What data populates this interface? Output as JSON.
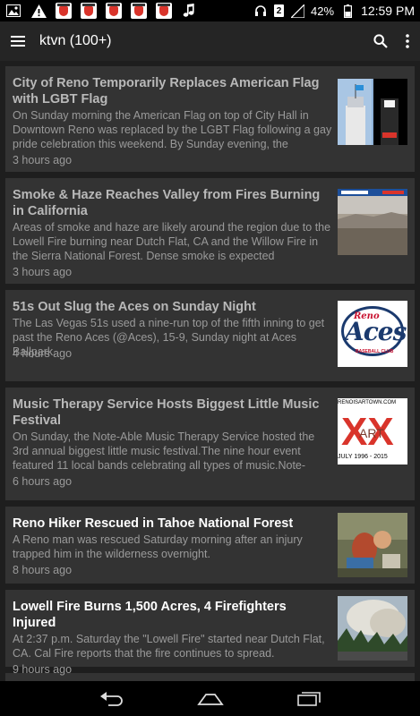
{
  "status_bar": {
    "battery": "42%",
    "time": "12:59 PM",
    "sim_label": "2"
  },
  "app_bar": {
    "title": "ktvn (100+)"
  },
  "articles": [
    {
      "title": "City of Reno Temporarily Replaces American Flag with LGBT Flag",
      "snippet": "On Sunday morning the American Flag on top of City Hall in Downtown Reno was replaced by the LGBT Flag following a gay pride celebration this weekend. By Sunday evening, the",
      "time": "3 hours ago",
      "thumb": "flag-photo"
    },
    {
      "title": "Smoke & Haze Reaches Valley from Fires Burning in California",
      "snippet": "Areas of smoke and haze are likely around the region due to the Lowell Fire burning near Dutch Flat, CA and the Willow Fire in the Sierra National Forest. Dense smoke is expected",
      "time": "3 hours ago",
      "thumb": "haze-photo"
    },
    {
      "title": "51s Out Slug the Aces on Sunday Night",
      "snippet": "The Las Vegas 51s used a nine-run top of the fifth inning to get past the Reno Aces (@Aces), 15-9, Sunday night at Aces Ballpark.",
      "time": "4 hours ago",
      "thumb": "aces-logo",
      "thumb_text": "Aces",
      "thumb_small": "Reno",
      "thumb_sub": "BASEBALL CLUB"
    },
    {
      "title": "Music Therapy Service Hosts Biggest Little Music Festival",
      "snippet": "On Sunday, the Note-Able Music Therapy Service hosted the 3rd annual biggest little music festival.The nine hour event featured 11 local bands celebrating all types of music.Note-",
      "time": "6 hours ago",
      "thumb": "artown-logo",
      "thumb_top": "RENOISARTOWN.COM",
      "thumb_bottom": "JULY 1996 - 2015"
    },
    {
      "title": "Reno Hiker Rescued in Tahoe National Forest",
      "snippet": "A Reno man was rescued Saturday morning after an injury trapped him in the wilderness overnight.",
      "time": "8 hours ago",
      "thumb": "rescue-photo"
    },
    {
      "title": "Lowell Fire Burns 1,500 Acres, 4 Firefighters Injured",
      "snippet": "At 2:37 p.m. Saturday the \"Lowell Fire\" started near Dutch Flat, CA. Cal Fire reports that the fire continues to spread.",
      "time": "9 hours ago",
      "thumb": "fire-photo"
    }
  ],
  "colors": {
    "background": "#1e1e1e",
    "card": "#333333",
    "app_bar": "#252525",
    "read_title": "#b9b9b9",
    "unread_title": "#ffffff"
  }
}
